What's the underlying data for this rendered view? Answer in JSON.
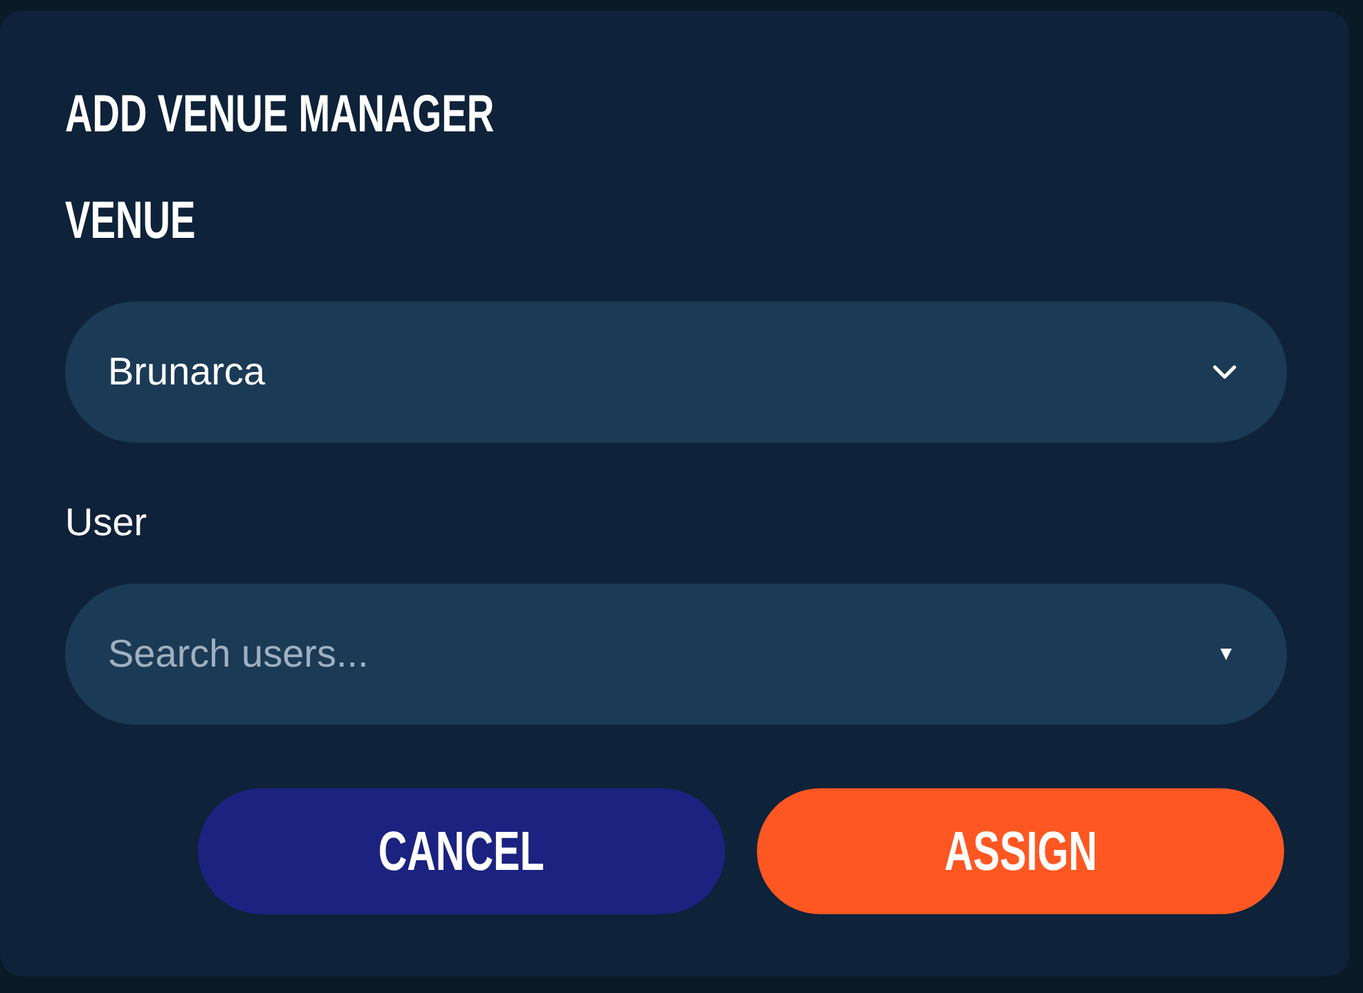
{
  "dialog": {
    "title": "ADD VENUE MANAGER",
    "venue": {
      "label": "VENUE",
      "value": "Brunarca"
    },
    "user": {
      "label": "User",
      "placeholder": "Search users...",
      "arrow": "▼"
    },
    "buttons": [
      {
        "kind": "secondary",
        "label": "CANCEL"
      },
      {
        "kind": "primary",
        "label": "ASSIGN"
      }
    ]
  }
}
